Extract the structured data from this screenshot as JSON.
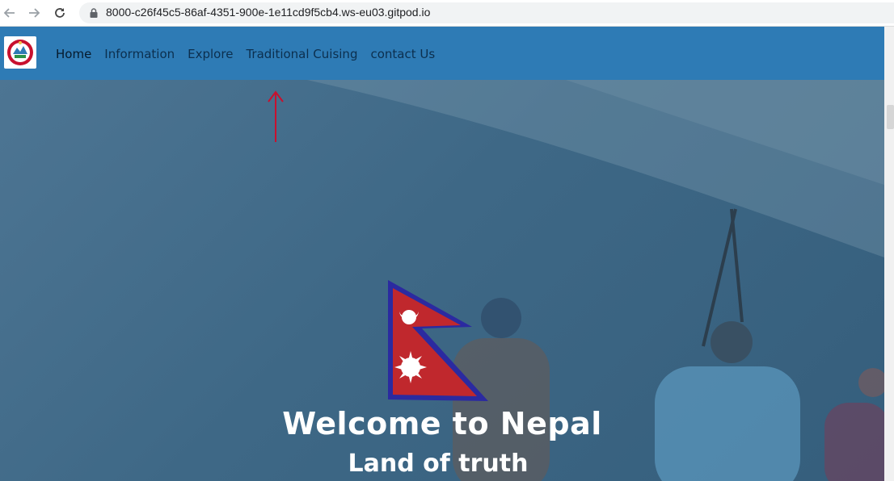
{
  "browser": {
    "url": "8000-c26f45c5-86af-4351-900e-1e11cd9f5cb4.ws-eu03.gitpod.io",
    "icons": [
      "back-arrow-icon",
      "forward-arrow-icon",
      "reload-icon",
      "lock-icon"
    ]
  },
  "header": {
    "logo_icon": "nepal-emblem-icon",
    "background_color": "#2e7bb5",
    "menu": [
      {
        "label": "Home"
      },
      {
        "label": "Information"
      },
      {
        "label": "Explore"
      },
      {
        "label": "Traditional Cuising"
      },
      {
        "label": "contact Us"
      }
    ]
  },
  "hero": {
    "flag_icon": "nepal-flag-icon",
    "title": "Welcome to Nepal",
    "subtitle": "Land of truth"
  },
  "annotation": {
    "icon": "red-up-arrow-icon",
    "color": "#c8102e"
  }
}
